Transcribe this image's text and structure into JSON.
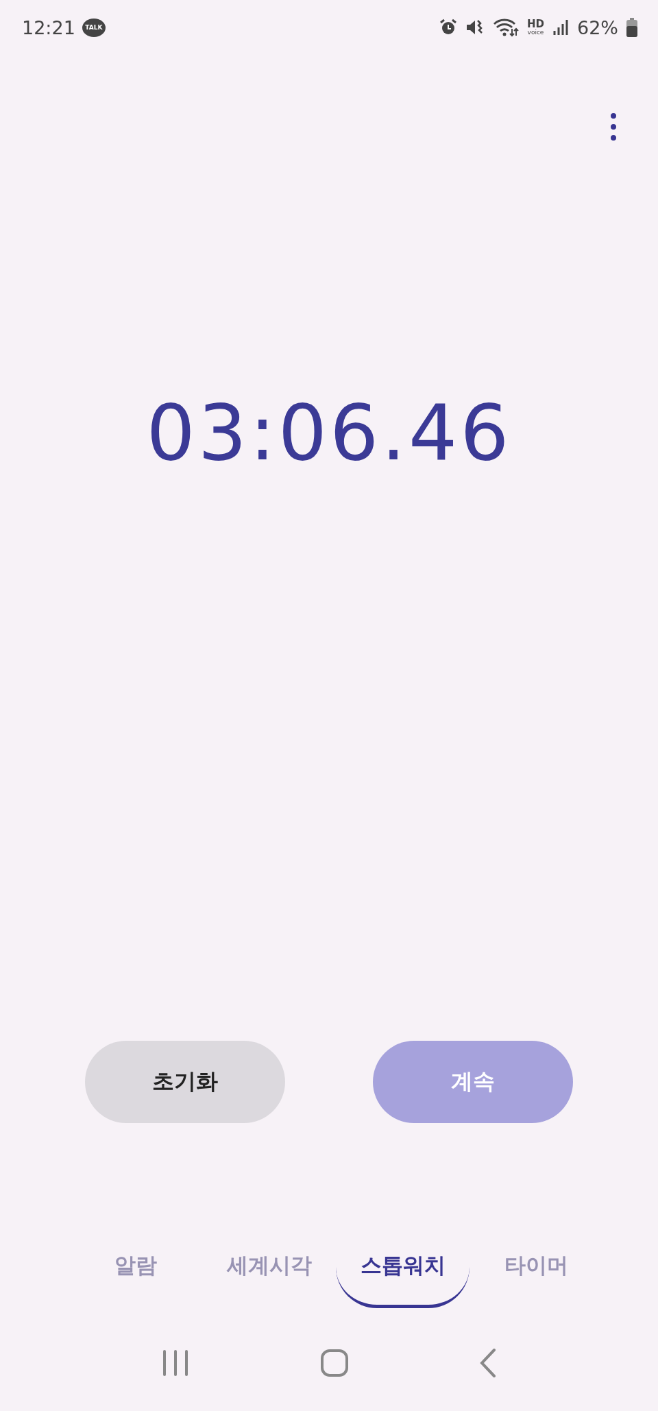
{
  "status_bar": {
    "time": "12:21",
    "notification_badge": "TALK",
    "hd_label": "HD",
    "voice_label": "voice",
    "battery": "62%"
  },
  "stopwatch": {
    "time": "03:06.46"
  },
  "buttons": [
    {
      "label": "초기화",
      "kind": "secondary"
    },
    {
      "label": "계속",
      "kind": "primary"
    }
  ],
  "tabs": [
    {
      "label": "알람",
      "selected": false
    },
    {
      "label": "세계시각",
      "selected": false
    },
    {
      "label": "스톱워치",
      "selected": true
    },
    {
      "label": "타이머",
      "selected": false
    }
  ]
}
